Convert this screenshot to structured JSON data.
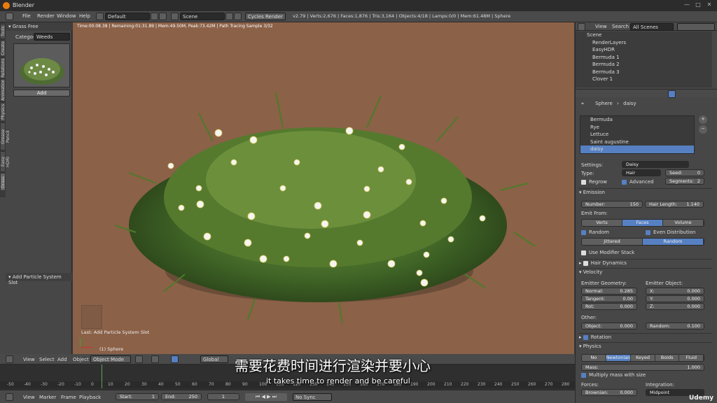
{
  "app": {
    "title": "Blender"
  },
  "menu": [
    "File",
    "Render",
    "Window",
    "Help"
  ],
  "layout_field": "Default",
  "scene_field": "Scene",
  "render_engine": "Cycles Render",
  "stats": "v2.79 | Verts:2,676 | Faces:1,876 | Tris:3,164 | Objects:4/18 | Lamps:0/0 | Mem:61.48M | Sphere",
  "left_panel": {
    "title": "Grass Free",
    "category_label": "Categor",
    "category_value": "Weeds",
    "add_button": "Add",
    "operator_title": "Add Particle System Slot",
    "tabs": [
      "Tools",
      "Create",
      "Relations",
      "Animation",
      "Physics",
      "Grease Pencil",
      "Easy HDRI",
      "Grass"
    ]
  },
  "viewport": {
    "render_info": "Time:00:08.38 | Remaining:01:31.89 | Mem:49.50M, Peak:73.42M | Path Tracing Sample 3/32",
    "last_op": "Last: Add Particle System Slot",
    "object_name": "(1) Sphere"
  },
  "viewport_header": {
    "menus": [
      "View",
      "Select",
      "Add",
      "Object"
    ],
    "mode": "Object Mode",
    "orientation": "Global"
  },
  "outliner": {
    "menus": [
      "View",
      "Search"
    ],
    "filter": "All Scenes",
    "rows": [
      "Scene",
      "RenderLayers",
      "EasyHDR",
      "Bermuda 1",
      "Bermuda 2",
      "Bermuda 3",
      "Clover 1"
    ]
  },
  "properties": {
    "breadcrumb": [
      "Sphere",
      "daisy"
    ],
    "particle_systems": [
      "Bermuda",
      "Rye",
      "Lettuce",
      "Saint augustine",
      "daisy"
    ],
    "settings_label": "Settings:",
    "settings_value": "Daisy",
    "type_label": "Type:",
    "type_value": "Hair",
    "seed_label": "Seed:",
    "seed_value": "0",
    "regrow": "Regrow",
    "advanced": "Advanced",
    "segments_label": "Segments:",
    "segments_value": "2",
    "emission": "Emission",
    "number_label": "Number:",
    "number_value": "150",
    "hair_length_label": "Hair Length:",
    "hair_length_value": "1.140",
    "emit_from": "Emit From:",
    "emit_options": [
      "Verts",
      "Faces",
      "Volume"
    ],
    "random": "Random",
    "even_distribution": "Even Distribution",
    "dist_options": [
      "Jittered",
      "Random"
    ],
    "use_modifier_stack": "Use Modifier Stack",
    "hair_dynamics": "Hair Dynamics",
    "velocity": "Velocity",
    "emitter_geometry": "Emitter Geometry:",
    "emitter_object": "Emitter Object:",
    "normal_label": "Normal:",
    "normal_value": "0.285",
    "tangent_label": "Tangent:",
    "tangent_value": "0.00",
    "rot_label": "Rot:",
    "rot_value": "0.000",
    "x_label": "X:",
    "x_value": "0.000",
    "y_label": "Y:",
    "y_value": "0.000",
    "z_label": "Z:",
    "z_value": "0.000",
    "other": "Other:",
    "object_label": "Object:",
    "object_value": "0.000",
    "random_label": "Random:",
    "random_value": "0.100",
    "rotation": "Rotation",
    "physics": "Physics",
    "physics_options": [
      "No",
      "Newtonian",
      "Keyed",
      "Boids",
      "Fluid"
    ],
    "mass_label": "Mass:",
    "mass_value": "1.000",
    "multiply_mass": "Multiply mass with size",
    "forces": "Forces:",
    "integration": "Integration:",
    "brownian_label": "Brownian:",
    "brownian_value": "0.000",
    "integration_value": "Midpoint"
  },
  "timeline": {
    "menus": [
      "View",
      "Marker",
      "Frame",
      "Playback"
    ],
    "start_label": "Start:",
    "start_value": "1",
    "end_label": "End:",
    "end_value": "250",
    "current_frame": "1",
    "sync": "No Sync",
    "ticks": [
      "-50",
      "-40",
      "-30",
      "-20",
      "-10",
      "0",
      "10",
      "20",
      "30",
      "40",
      "50",
      "60",
      "70",
      "80",
      "90",
      "100",
      "110",
      "120",
      "130",
      "140",
      "150",
      "160",
      "170",
      "180",
      "190",
      "200",
      "210",
      "220",
      "230",
      "240",
      "250",
      "260",
      "270",
      "280"
    ]
  },
  "subtitles": {
    "cn": "需要花费时间进行渲染并要小心",
    "en": "it takes time to render and be careful"
  },
  "watermark": "Udemy"
}
